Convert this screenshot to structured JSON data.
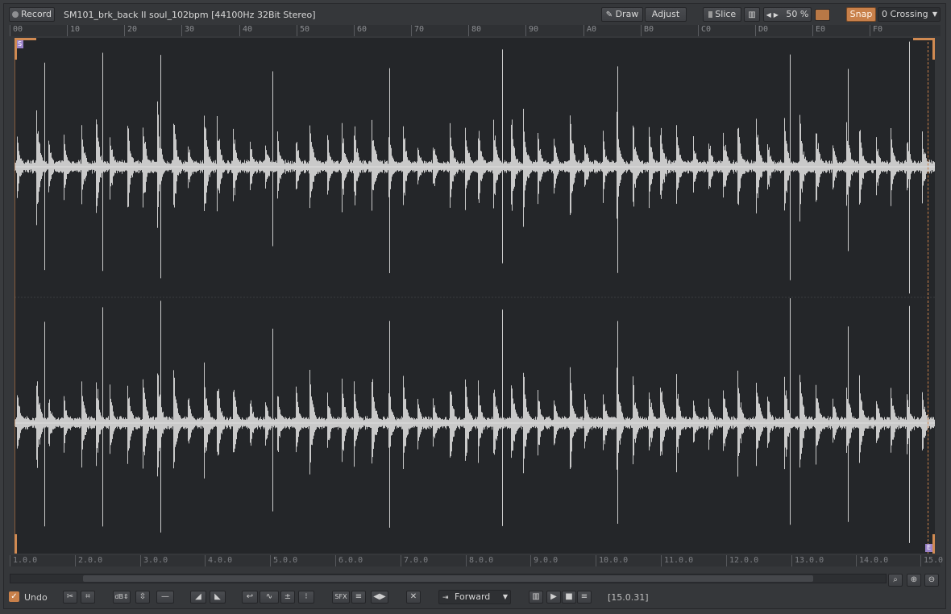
{
  "toolbar": {
    "record_label": "Record",
    "file_title": "SM101_brk_back II soul_102bpm [44100Hz 32Bit Stereo]",
    "draw_label": "Draw",
    "adjust_label": "Adjust",
    "slice_label": "Slice",
    "zoom_value": "50 %",
    "snap_label": "Snap",
    "snap_mode": "0 Crossing",
    "accent_color": "#c8804a"
  },
  "ruler_top": [
    "00",
    "10",
    "20",
    "30",
    "40",
    "50",
    "60",
    "70",
    "80",
    "90",
    "A0",
    "B0",
    "C0",
    "D0",
    "E0",
    "F0"
  ],
  "ruler_bottom": [
    "1.0.0",
    "2.0.0",
    "3.0.0",
    "4.0.0",
    "5.0.0",
    "6.0.0",
    "7.0.0",
    "8.0.0",
    "9.0.0",
    "10.0.0",
    "11.0.0",
    "12.0.0",
    "13.0.0",
    "14.0.0",
    "15.0"
  ],
  "markers": {
    "start": "S",
    "end": "E"
  },
  "bottom": {
    "undo_label": "Undo",
    "sfx_label": "SFX",
    "loop_mode": "Forward",
    "position": "[15.0.31]"
  },
  "icons": [
    "record-icon",
    "pencil-icon",
    "slice-icon",
    "keyboard-icon",
    "arrow-left-icon",
    "arrow-right-icon",
    "color-swatch-icon",
    "chevron-down-icon",
    "search-icon",
    "zoom-in-icon",
    "zoom-out-icon",
    "scissors-icon",
    "crop-icon",
    "db-icon",
    "normalize-icon",
    "line-icon",
    "fade-in-icon",
    "fade-out-icon",
    "reverse-icon",
    "shape-icon",
    "dc-icon",
    "channels-icon",
    "menu-icon",
    "mirror-icon",
    "x-icon",
    "loop-icon",
    "piano-icon",
    "play-icon",
    "stop-icon",
    "list-icon"
  ]
}
